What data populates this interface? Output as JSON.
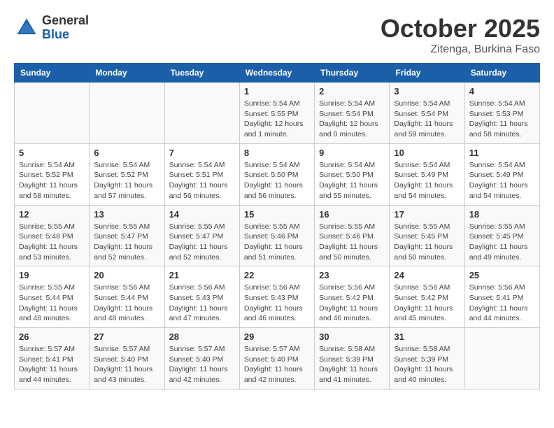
{
  "logo": {
    "general": "General",
    "blue": "Blue"
  },
  "header": {
    "title": "October 2025",
    "subtitle": "Zitenga, Burkina Faso"
  },
  "weekdays": [
    "Sunday",
    "Monday",
    "Tuesday",
    "Wednesday",
    "Thursday",
    "Friday",
    "Saturday"
  ],
  "weeks": [
    [
      {
        "day": "",
        "info": ""
      },
      {
        "day": "",
        "info": ""
      },
      {
        "day": "",
        "info": ""
      },
      {
        "day": "1",
        "info": "Sunrise: 5:54 AM\nSunset: 5:55 PM\nDaylight: 12 hours\nand 1 minute."
      },
      {
        "day": "2",
        "info": "Sunrise: 5:54 AM\nSunset: 5:54 PM\nDaylight: 12 hours\nand 0 minutes."
      },
      {
        "day": "3",
        "info": "Sunrise: 5:54 AM\nSunset: 5:54 PM\nDaylight: 11 hours\nand 59 minutes."
      },
      {
        "day": "4",
        "info": "Sunrise: 5:54 AM\nSunset: 5:53 PM\nDaylight: 11 hours\nand 58 minutes."
      }
    ],
    [
      {
        "day": "5",
        "info": "Sunrise: 5:54 AM\nSunset: 5:52 PM\nDaylight: 11 hours\nand 58 minutes."
      },
      {
        "day": "6",
        "info": "Sunrise: 5:54 AM\nSunset: 5:52 PM\nDaylight: 11 hours\nand 57 minutes."
      },
      {
        "day": "7",
        "info": "Sunrise: 5:54 AM\nSunset: 5:51 PM\nDaylight: 11 hours\nand 56 minutes."
      },
      {
        "day": "8",
        "info": "Sunrise: 5:54 AM\nSunset: 5:50 PM\nDaylight: 11 hours\nand 56 minutes."
      },
      {
        "day": "9",
        "info": "Sunrise: 5:54 AM\nSunset: 5:50 PM\nDaylight: 11 hours\nand 55 minutes."
      },
      {
        "day": "10",
        "info": "Sunrise: 5:54 AM\nSunset: 5:49 PM\nDaylight: 11 hours\nand 54 minutes."
      },
      {
        "day": "11",
        "info": "Sunrise: 5:54 AM\nSunset: 5:49 PM\nDaylight: 11 hours\nand 54 minutes."
      }
    ],
    [
      {
        "day": "12",
        "info": "Sunrise: 5:55 AM\nSunset: 5:48 PM\nDaylight: 11 hours\nand 53 minutes."
      },
      {
        "day": "13",
        "info": "Sunrise: 5:55 AM\nSunset: 5:47 PM\nDaylight: 11 hours\nand 52 minutes."
      },
      {
        "day": "14",
        "info": "Sunrise: 5:55 AM\nSunset: 5:47 PM\nDaylight: 11 hours\nand 52 minutes."
      },
      {
        "day": "15",
        "info": "Sunrise: 5:55 AM\nSunset: 5:46 PM\nDaylight: 11 hours\nand 51 minutes."
      },
      {
        "day": "16",
        "info": "Sunrise: 5:55 AM\nSunset: 5:46 PM\nDaylight: 11 hours\nand 50 minutes."
      },
      {
        "day": "17",
        "info": "Sunrise: 5:55 AM\nSunset: 5:45 PM\nDaylight: 11 hours\nand 50 minutes."
      },
      {
        "day": "18",
        "info": "Sunrise: 5:55 AM\nSunset: 5:45 PM\nDaylight: 11 hours\nand 49 minutes."
      }
    ],
    [
      {
        "day": "19",
        "info": "Sunrise: 5:55 AM\nSunset: 5:44 PM\nDaylight: 11 hours\nand 48 minutes."
      },
      {
        "day": "20",
        "info": "Sunrise: 5:56 AM\nSunset: 5:44 PM\nDaylight: 11 hours\nand 48 minutes."
      },
      {
        "day": "21",
        "info": "Sunrise: 5:56 AM\nSunset: 5:43 PM\nDaylight: 11 hours\nand 47 minutes."
      },
      {
        "day": "22",
        "info": "Sunrise: 5:56 AM\nSunset: 5:43 PM\nDaylight: 11 hours\nand 46 minutes."
      },
      {
        "day": "23",
        "info": "Sunrise: 5:56 AM\nSunset: 5:42 PM\nDaylight: 11 hours\nand 46 minutes."
      },
      {
        "day": "24",
        "info": "Sunrise: 5:56 AM\nSunset: 5:42 PM\nDaylight: 11 hours\nand 45 minutes."
      },
      {
        "day": "25",
        "info": "Sunrise: 5:56 AM\nSunset: 5:41 PM\nDaylight: 11 hours\nand 44 minutes."
      }
    ],
    [
      {
        "day": "26",
        "info": "Sunrise: 5:57 AM\nSunset: 5:41 PM\nDaylight: 11 hours\nand 44 minutes."
      },
      {
        "day": "27",
        "info": "Sunrise: 5:57 AM\nSunset: 5:40 PM\nDaylight: 11 hours\nand 43 minutes."
      },
      {
        "day": "28",
        "info": "Sunrise: 5:57 AM\nSunset: 5:40 PM\nDaylight: 11 hours\nand 42 minutes."
      },
      {
        "day": "29",
        "info": "Sunrise: 5:57 AM\nSunset: 5:40 PM\nDaylight: 11 hours\nand 42 minutes."
      },
      {
        "day": "30",
        "info": "Sunrise: 5:58 AM\nSunset: 5:39 PM\nDaylight: 11 hours\nand 41 minutes."
      },
      {
        "day": "31",
        "info": "Sunrise: 5:58 AM\nSunset: 5:39 PM\nDaylight: 11 hours\nand 40 minutes."
      },
      {
        "day": "",
        "info": ""
      }
    ]
  ]
}
